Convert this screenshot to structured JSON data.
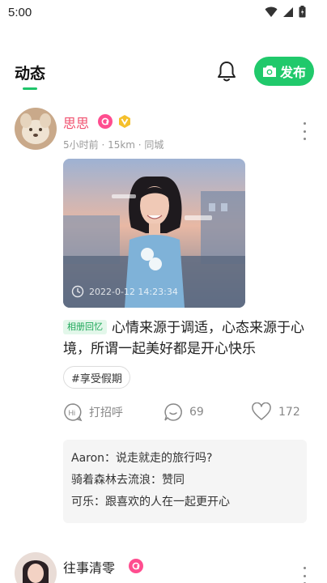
{
  "status_bar": {
    "time": "5:00"
  },
  "header": {
    "tab_title": "动态",
    "publish_label": "发布",
    "accent_color": "#20c96b"
  },
  "posts": [
    {
      "username": "思思",
      "meta": "5小时前 · 15km · 同城",
      "photo_timestamp": "2022-0-12  14:23:34",
      "album_tag": "相册回忆",
      "text": "心情来源于调适，心态来源于心境，所谓一起美好都是开心快乐",
      "hashtag": "#享受假期",
      "actions": {
        "greet_label": "打招呼",
        "comment_count": "69",
        "like_count": "172"
      },
      "comments": [
        {
          "author": "Aaron",
          "text": "说走就走的旅行吗?"
        },
        {
          "author": "骑着森林去流浪",
          "text": "赞同"
        },
        {
          "author": "可乐",
          "text": "跟喜欢的人在一起更开心"
        }
      ]
    },
    {
      "username": "往事清零"
    }
  ]
}
